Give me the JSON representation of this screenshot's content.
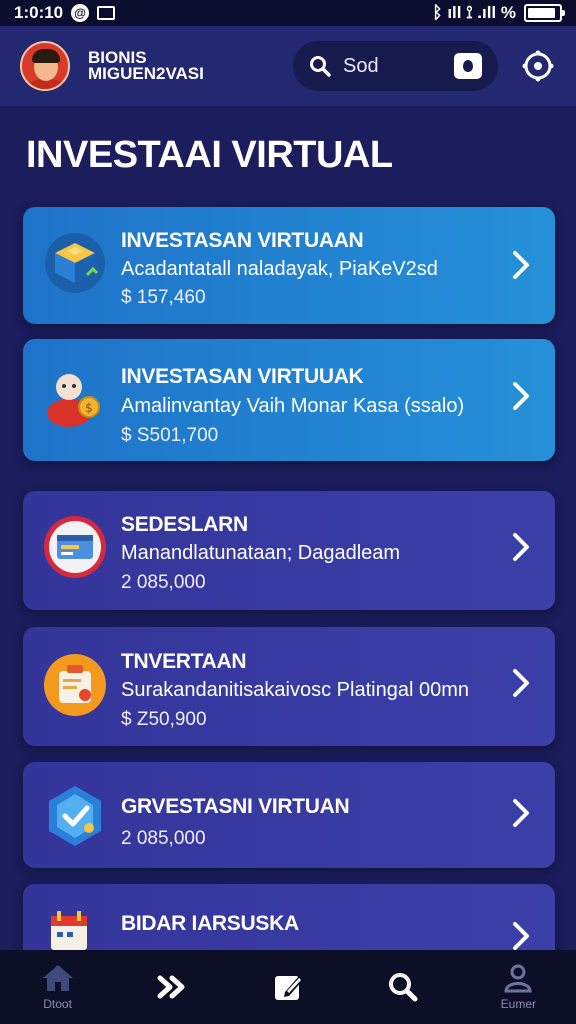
{
  "status_bar": {
    "time": "1:0:10",
    "badge": "@",
    "right_text": "ᛒ ıll ⟟ .ıll %",
    "battery_level": 0.8
  },
  "header": {
    "app_title_line1": "BIONIS",
    "app_title_line2": "MIGUEN2VASI",
    "search_text": "Sod",
    "colors": {
      "header_bg": "#232870",
      "search_bg": "#161a4d"
    }
  },
  "page_title": "INVESTAAI VIRTUAL",
  "cards": [
    {
      "title": "INVESTASAN VIRTUAAN",
      "subtitle": "Acadantatall naladayak, PiaKeV2sd",
      "amount": "$ 157,460",
      "style": "blue",
      "icon": "cube-icon"
    },
    {
      "title": "INVESTASAN VIRTUUAK",
      "subtitle": "Amalinvantay Vaih Monar Kasa (ssalo)",
      "amount": "$ S501,700",
      "style": "blue",
      "icon": "person-coin-icon"
    },
    {
      "title": "SEDESLARN",
      "subtitle": "Manandlatunataan; Dagadleam",
      "amount": "2 085,000",
      "style": "purple",
      "icon": "card-icon"
    },
    {
      "title": "TNVERTAAN",
      "subtitle": "Surakandanitisakaivosc Platingal 00mn",
      "amount": "$ Z50,900",
      "style": "purple",
      "icon": "briefcase-icon"
    },
    {
      "title": "GRVESTASNI VIRTUAN",
      "subtitle": "",
      "amount": "2 085,000",
      "style": "purple",
      "icon": "shield-check-icon"
    },
    {
      "title": "BIDAR IARSUSKA",
      "subtitle": "",
      "amount": "",
      "style": "purple",
      "icon": "calendar-icon"
    }
  ],
  "bottom_nav": [
    {
      "label": "Dtoot",
      "icon": "home-icon"
    },
    {
      "label": "",
      "icon": "forward-icon"
    },
    {
      "label": "",
      "icon": "edit-icon"
    },
    {
      "label": "",
      "icon": "search-icon"
    },
    {
      "label": "Eumer",
      "icon": "profile-icon"
    }
  ]
}
